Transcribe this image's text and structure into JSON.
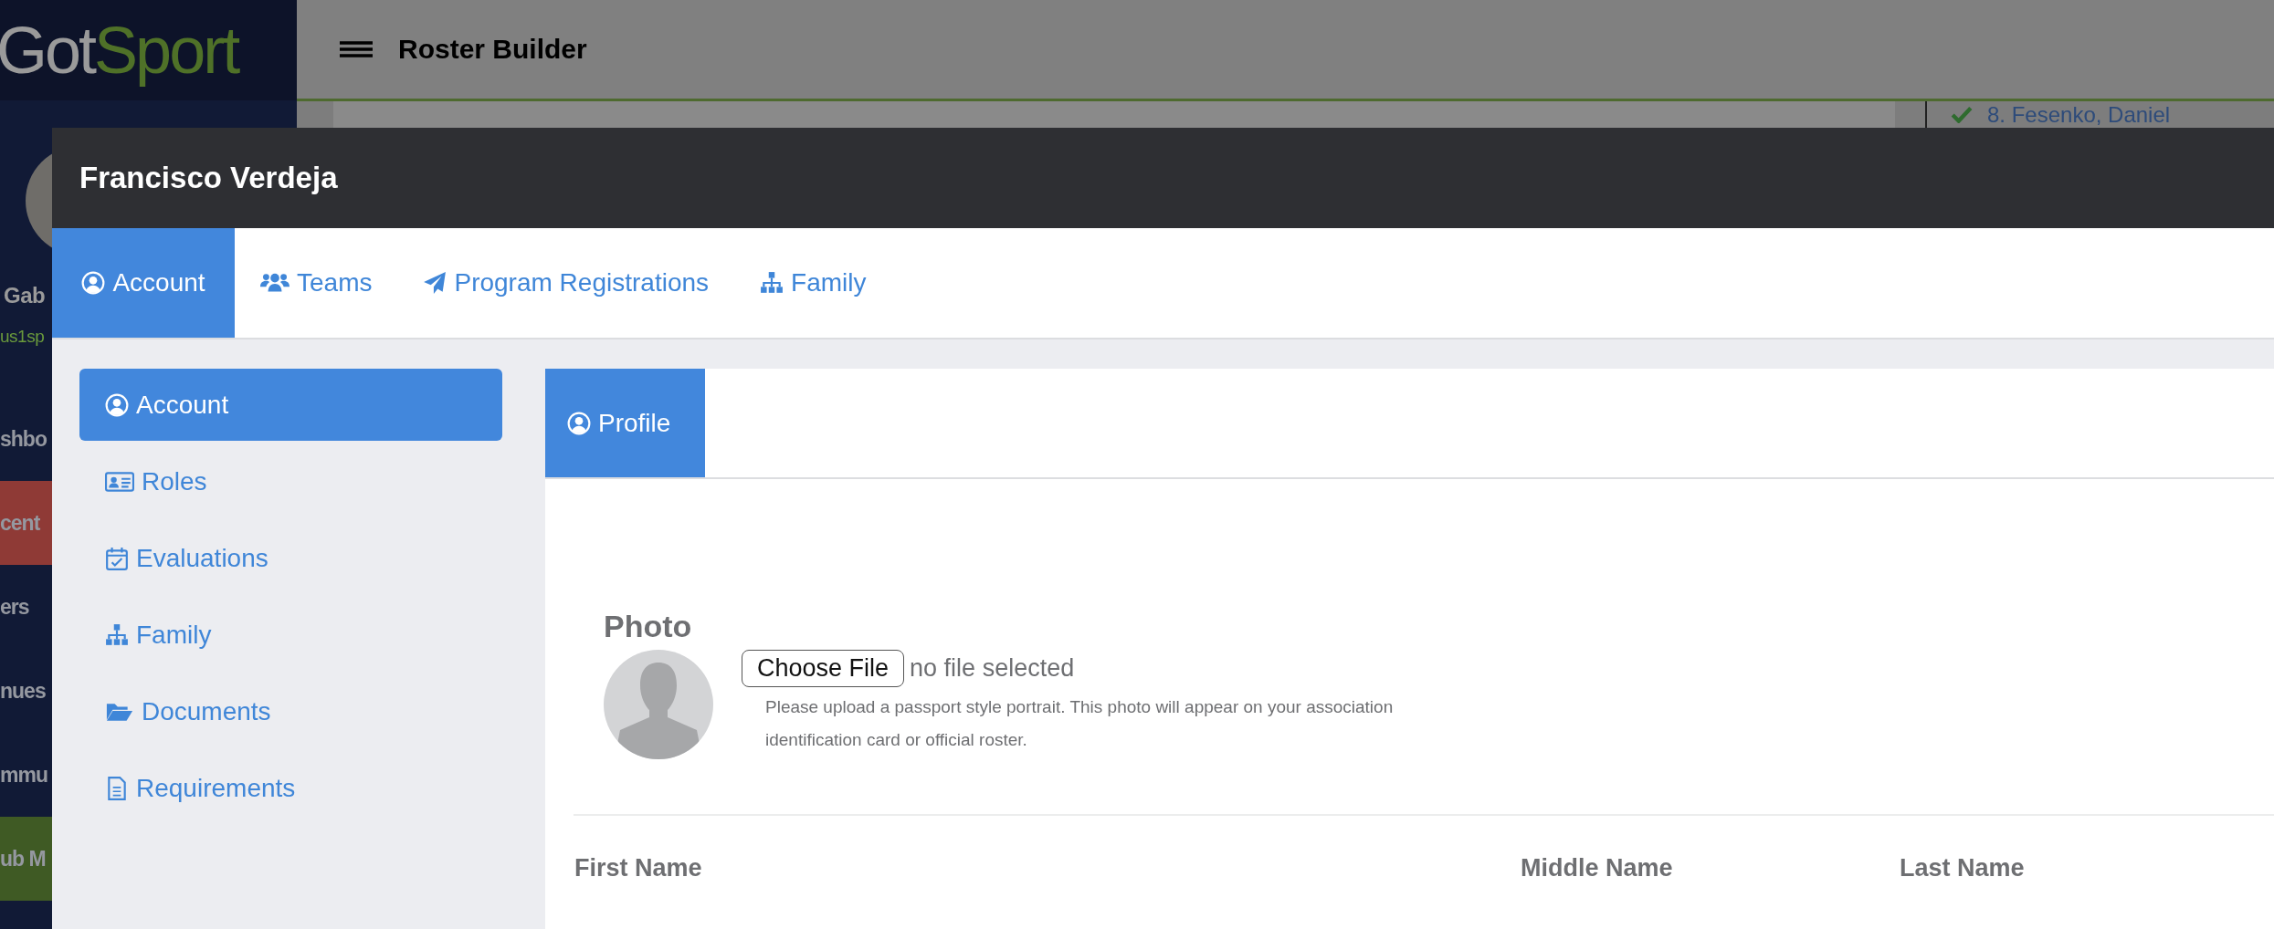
{
  "app": {
    "logo": [
      "Got",
      "Sport"
    ],
    "page_title": "Roster Builder",
    "sidebar_fragments": [
      {
        "text": "Gab",
        "kind": "name"
      },
      {
        "text": "us1sp",
        "kind": "username"
      },
      {
        "text": "shbo",
        "kind": "nav"
      },
      {
        "text": "cent",
        "kind": "nav",
        "color": "#8f3a36"
      },
      {
        "text": "ers",
        "kind": "nav"
      },
      {
        "text": "nues",
        "kind": "nav"
      },
      {
        "text": "mmu",
        "kind": "nav"
      },
      {
        "text": "ub M",
        "kind": "nav",
        "color": "#3f5a24"
      }
    ],
    "roster_entry": "8. Fesenko, Daniel"
  },
  "modal": {
    "title": "Francisco Verdeja",
    "tabs": [
      {
        "label": "Account",
        "kind": "account",
        "selected": true
      },
      {
        "label": "Teams",
        "kind": "teams",
        "selected": false
      },
      {
        "label": "Program Registrations",
        "kind": "registrations",
        "selected": false
      },
      {
        "label": "Family",
        "kind": "family",
        "selected": false
      }
    ],
    "nav": [
      {
        "label": "Account",
        "kind": "account",
        "selected": true
      },
      {
        "label": "Roles",
        "kind": "roles",
        "selected": false
      },
      {
        "label": "Evaluations",
        "kind": "evaluations",
        "selected": false
      },
      {
        "label": "Family",
        "kind": "family",
        "selected": false
      },
      {
        "label": "Documents",
        "kind": "documents",
        "selected": false
      },
      {
        "label": "Requirements",
        "kind": "requirements",
        "selected": false
      }
    ],
    "panel_tabs": [
      {
        "label": "Profile",
        "kind": "account",
        "selected": true
      }
    ],
    "photo": {
      "label": "Photo",
      "button": "Choose File",
      "file_status": "no file selected",
      "help": "Please upload a passport style portrait. This photo will appear on your association identification card or official roster."
    },
    "fields": [
      "First Name",
      "Middle Name",
      "Last Name"
    ]
  }
}
